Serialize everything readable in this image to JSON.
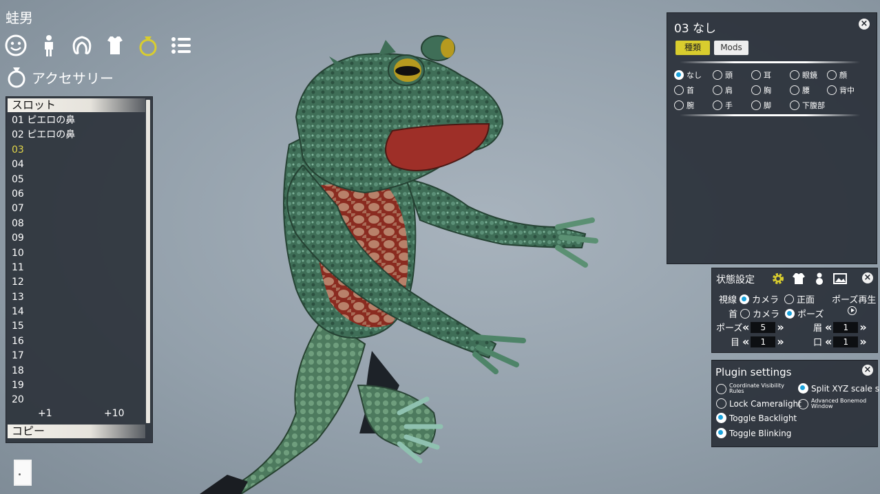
{
  "character_name": "蛙男",
  "categories": [
    {
      "icon": "face-icon",
      "active": false
    },
    {
      "icon": "body-icon",
      "active": false
    },
    {
      "icon": "hair-icon",
      "active": false
    },
    {
      "icon": "clothes-icon",
      "active": false
    },
    {
      "icon": "ring-icon",
      "active": true
    },
    {
      "icon": "list-icon",
      "active": false
    }
  ],
  "section": {
    "icon": "ring-icon",
    "title": "アクセサリー"
  },
  "slot_panel": {
    "header": "スロット",
    "items": [
      "01 ピエロの鼻",
      "02 ピエロの鼻",
      "03",
      "04",
      "05",
      "06",
      "07",
      "08",
      "09",
      "10",
      "11",
      "12",
      "13",
      "14",
      "15",
      "16",
      "17",
      "18",
      "19",
      "20"
    ],
    "selected_index": 2,
    "add_one": "+1",
    "add_ten": "+10",
    "copy_header": "コピー"
  },
  "accessory_panel": {
    "title": "03 なし",
    "close": "×",
    "tab_kind": "種類",
    "tab_mods": "Mods",
    "kinds": [
      {
        "label": "なし",
        "selected": true
      },
      {
        "label": "頭",
        "selected": false
      },
      {
        "label": "耳",
        "selected": false
      },
      {
        "label": "眼鏡",
        "selected": false
      },
      {
        "label": "顔",
        "selected": false
      },
      {
        "label": "首",
        "selected": false
      },
      {
        "label": "肩",
        "selected": false
      },
      {
        "label": "胸",
        "selected": false
      },
      {
        "label": "腰",
        "selected": false
      },
      {
        "label": "背中",
        "selected": false
      },
      {
        "label": "腕",
        "selected": false
      },
      {
        "label": "手",
        "selected": false
      },
      {
        "label": "脚",
        "selected": false
      },
      {
        "label": "下腹部",
        "selected": false
      }
    ]
  },
  "state_panel": {
    "title": "状態設定",
    "close": "×",
    "icons": [
      "gear-icon",
      "shirt-icon",
      "snowman-icon",
      "image-icon"
    ],
    "gaze_label": "視線",
    "gaze_camera": "カメラ",
    "gaze_front": "正面",
    "gaze_selected": "camera",
    "neck_label": "首",
    "neck_camera": "カメラ",
    "neck_pose": "ポーズ",
    "neck_selected": "pose",
    "pose_play_label": "ポーズ再生",
    "pose_label": "ポーズ",
    "pose_value": "5",
    "eyebrow_label": "眉",
    "eyebrow_value": "1",
    "eye_label": "目",
    "eye_value": "1",
    "mouth_label": "口",
    "mouth_value": "1"
  },
  "plugin_panel": {
    "title": "Plugin settings",
    "close": "×",
    "options": [
      {
        "label": "Coordinate Visibility Rules",
        "checked": false,
        "small": true
      },
      {
        "label": "Split XYZ scale sliders",
        "checked": true,
        "small": false
      },
      {
        "label": "Lock Cameralight",
        "checked": false,
        "small": false
      },
      {
        "label": "Advanced Bonemod Window",
        "checked": false,
        "small": true
      },
      {
        "label": "Toggle Backlight",
        "checked": true,
        "small": false
      },
      {
        "label": "Toggle Blinking",
        "checked": true,
        "small": false
      }
    ]
  },
  "colors": {
    "accent_yellow": "#d9cd2e",
    "radio_blue": "#1aa2dc",
    "panel_bg": "#282e36"
  }
}
